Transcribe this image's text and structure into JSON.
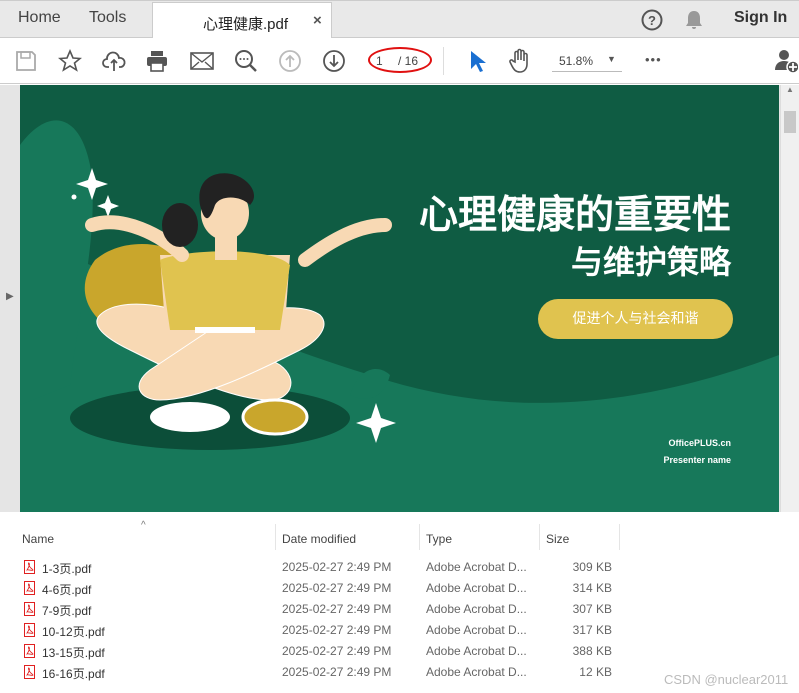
{
  "tabs": {
    "home": "Home",
    "tools": "Tools",
    "document": "心理健康.pdf",
    "close": "×",
    "sign_in": "Sign In"
  },
  "toolbar": {
    "page_current": "1",
    "page_total": "/ 16",
    "zoom": "51.8%",
    "more": "•••"
  },
  "slide": {
    "title_line1": "心理健康的重要性",
    "title_line2": "与维护策略",
    "button": "促进个人与社会和谐",
    "brand": "OfficePLUS.cn",
    "presenter": "Presenter name",
    "colors": {
      "bg": "#0f5c43",
      "accent": "#e0c34f"
    }
  },
  "explorer": {
    "headers": [
      "Name",
      "Date modified",
      "Type",
      "Size"
    ],
    "files": [
      {
        "name": "1-3页.pdf",
        "date": "2025-02-27 2:49 PM",
        "type": "Adobe Acrobat D...",
        "size": "309 KB"
      },
      {
        "name": "4-6页.pdf",
        "date": "2025-02-27 2:49 PM",
        "type": "Adobe Acrobat D...",
        "size": "314 KB"
      },
      {
        "name": "7-9页.pdf",
        "date": "2025-02-27 2:49 PM",
        "type": "Adobe Acrobat D...",
        "size": "307 KB"
      },
      {
        "name": "10-12页.pdf",
        "date": "2025-02-27 2:49 PM",
        "type": "Adobe Acrobat D...",
        "size": "317 KB"
      },
      {
        "name": "13-15页.pdf",
        "date": "2025-02-27 2:49 PM",
        "type": "Adobe Acrobat D...",
        "size": "388 KB"
      },
      {
        "name": "16-16页.pdf",
        "date": "2025-02-27 2:49 PM",
        "type": "Adobe Acrobat D...",
        "size": "12 KB"
      }
    ]
  },
  "watermark": "CSDN @nuclear2011"
}
